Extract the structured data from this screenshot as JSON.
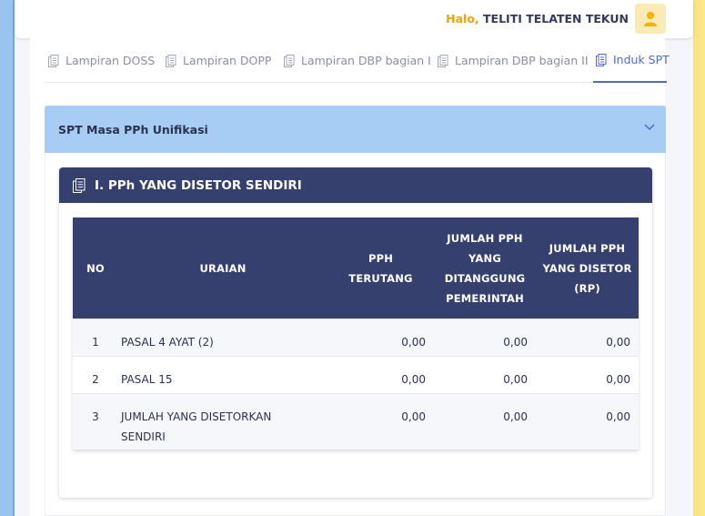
{
  "header": {
    "greeting": "Halo,",
    "user_name": "TELITI TELATEN TEKUN",
    "avatar_icon": "user-icon"
  },
  "tabs": [
    {
      "label": "Lampiran DOSS",
      "icon": "document-icon",
      "active": false
    },
    {
      "label": "Lampiran DOPP",
      "icon": "document-icon",
      "active": false
    },
    {
      "label": "Lampiran DBP bagian I",
      "icon": "document-icon",
      "active": false
    },
    {
      "label": "Lampiran DBP bagian II",
      "icon": "document-icon",
      "active": false
    },
    {
      "label": "Induk SPT",
      "icon": "document-icon",
      "active": true
    }
  ],
  "accordion": {
    "title": "SPT Masa PPh Unifikasi",
    "icon": "chevron-down-icon"
  },
  "section": {
    "title": "I. PPh YANG DISETOR SENDIRI",
    "icon": "document-icon"
  },
  "table": {
    "columns": [
      "NO",
      "URAIAN",
      "PPH TERUTANG",
      "JUMLAH PPH YANG DITANGGUNG PEMERINTAH",
      "JUMLAH PPH YANG DISETOR (RP)"
    ],
    "rows": [
      [
        "1",
        "PASAL 4 AYAT (2)",
        "0,00",
        "0,00",
        "0,00"
      ],
      [
        "2",
        "PASAL 15",
        "0,00",
        "0,00",
        "0,00"
      ],
      [
        "3",
        "JUMLAH YANG DISETORKAN SENDIRI",
        "0,00",
        "0,00",
        "0,00"
      ]
    ]
  },
  "colors": {
    "accent": "#4d6bcc",
    "table_header": "#36406e",
    "accordion_bg": "#a8cdf5",
    "greeting": "#f0a400"
  }
}
